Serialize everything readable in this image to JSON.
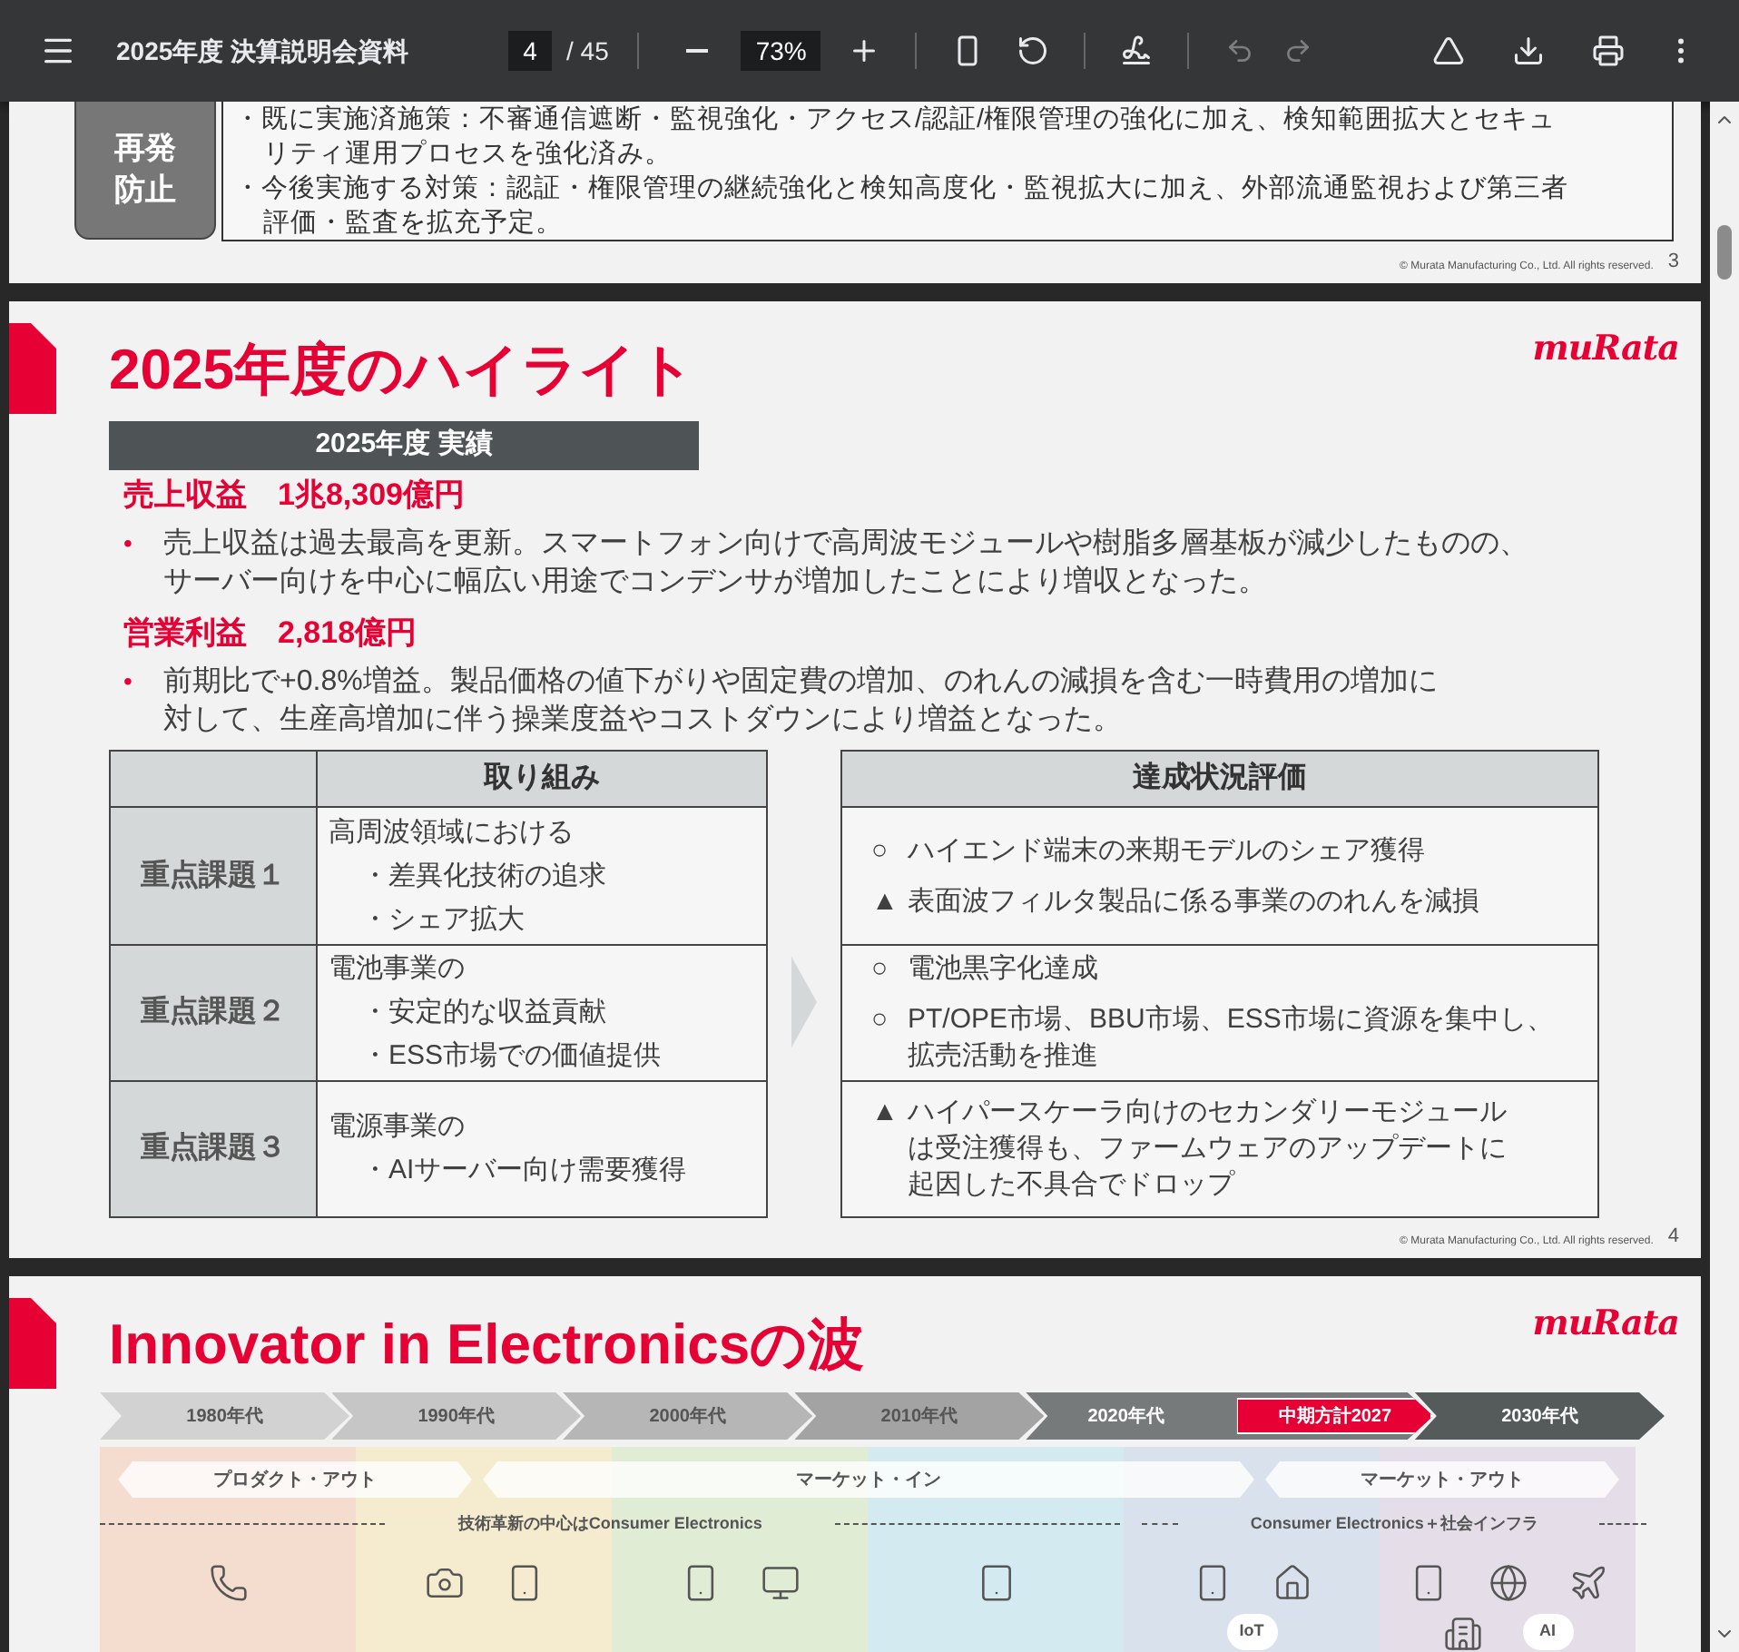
{
  "toolbar": {
    "title": "2025年度 決算説明会資料",
    "page": "4",
    "page_total": "/ 45",
    "zoom": "73%",
    "undo_disabled": true,
    "redo_disabled": true
  },
  "page3": {
    "label_lines": [
      "再発",
      "防止"
    ],
    "bullets": [
      {
        "lines": [
          "・既に実施済施策：不審通信遮断・監視強化・アクセス/認証/権限管理の強化に加え、検知範囲拡大とセキュ",
          "リティ運用プロセスを強化済み。"
        ]
      },
      {
        "lines": [
          "・今後実施する対策：認証・権限管理の継続強化と検知高度化・監視拡大に加え、外部流通監視および第三者",
          "評価・監査を拡充予定。"
        ]
      }
    ],
    "copyright": "© Murata Manufacturing Co., Ltd. All rights reserved.",
    "page_number": "3"
  },
  "page4": {
    "title": "2025年度のハイライト",
    "logo": "muRata",
    "section_header": "2025年度 実績",
    "metrics": [
      {
        "heading": "売上収益　1兆8,309億円",
        "bullet": "•",
        "lines": [
          "売上収益は過去最高を更新。スマートフォン向けで高周波モジュールや樹脂多層基板が減少したものの、",
          "サーバー向けを中心に幅広い用途でコンデンサが増加したことにより増収となった。"
        ]
      },
      {
        "heading": "営業利益　2,818億円",
        "bullet": "•",
        "lines": [
          "前期比で+0.8%増益。製品価格の値下がりや固定費の増加、のれんの減損を含む一時費用の増加に",
          "対して、生産高増加に伴う操業度益やコストダウンにより増益となった。"
        ]
      }
    ],
    "left_table": {
      "header": "取り組み",
      "rows": [
        {
          "label": "重点課題１",
          "intro": "高周波領域における",
          "items": [
            "・差異化技術の追求",
            "・シェア拡大"
          ]
        },
        {
          "label": "重点課題２",
          "intro": "電池事業の",
          "items": [
            "・安定的な収益貢献",
            "・ESS市場での価値提供"
          ]
        },
        {
          "label": "重点課題３",
          "intro": "電源事業の",
          "items": [
            "・AIサーバー向け需要獲得"
          ]
        }
      ]
    },
    "right_table": {
      "header": "達成状況評価",
      "rows": [
        [
          {
            "mark": "○",
            "lines": [
              "ハイエンド端末の来期モデルのシェア獲得"
            ]
          },
          {
            "mark": "▲",
            "lines": [
              "表面波フィルタ製品に係る事業ののれんを減損"
            ]
          }
        ],
        [
          {
            "mark": "○",
            "lines": [
              "電池黒字化達成"
            ]
          },
          {
            "mark": "○",
            "lines": [
              "PT/OPE市場、BBU市場、ESS市場に資源を集中し、",
              "拡売活動を推進"
            ]
          }
        ],
        [
          {
            "mark": "▲",
            "lines": [
              "ハイパースケーラ向けのセカンダリーモジュール",
              "は受注獲得も、ファームウェアのアップデートに",
              "起因した不具合でドロップ"
            ]
          }
        ]
      ]
    },
    "copyright": "© Murata Manufacturing Co., Ltd. All rights reserved.",
    "page_number": "4"
  },
  "page5": {
    "title": "Innovator in Electronicsの波",
    "logo": "muRata",
    "eras": [
      {
        "label": "1980年代",
        "color": "#d2d2d2"
      },
      {
        "label": "1990年代",
        "color": "#c6c6c6"
      },
      {
        "label": "2000年代",
        "color": "#b6b6b6"
      },
      {
        "label": "2010年代",
        "color": "#a3a3a3"
      },
      {
        "label": "2020年代",
        "color": "#777a7b"
      },
      {
        "label": "2030年代",
        "color": "#555a5b"
      }
    ],
    "plan": {
      "label": "中期方計2027",
      "color": "#e60033"
    },
    "columns": [
      {
        "color": "#f4dccf"
      },
      {
        "color": "#f5ebcf"
      },
      {
        "color": "#e1ecd5"
      },
      {
        "color": "#d3eaf1"
      },
      {
        "color": "#d9e2ec",
        "badge": "IoT"
      },
      {
        "color": "#e5dee9",
        "badge": "AI"
      }
    ],
    "phases": [
      "プロダクト・アウト",
      "マーケット・イン",
      "マーケット・アウト"
    ],
    "notes": [
      "技術革新の中心はConsumer Electronics",
      "Consumer Electronics＋社会インフラ"
    ]
  }
}
